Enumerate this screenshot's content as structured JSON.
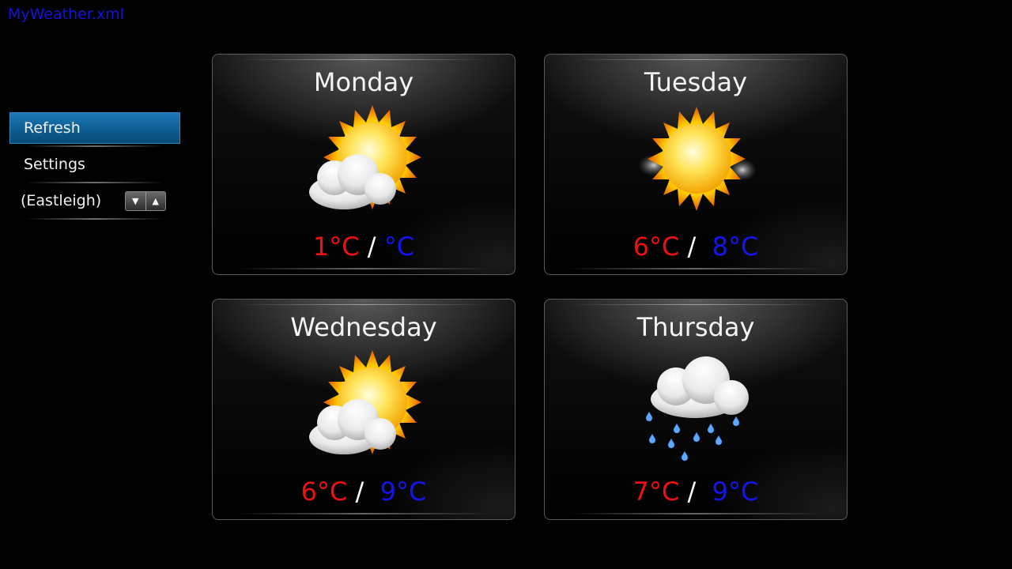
{
  "app": {
    "title": "MyWeather.xml"
  },
  "menu": {
    "refresh_label": "Refresh",
    "settings_label": "Settings",
    "location_label": "(Eastleigh)",
    "spinner_down": "▼",
    "spinner_up": "▲"
  },
  "days": [
    {
      "name": "Monday",
      "low": "1°C",
      "separator": " / ",
      "high": "°C",
      "icon": "partly-cloudy-icon"
    },
    {
      "name": "Tuesday",
      "low": "6°C",
      "separator": " /  ",
      "high": "8°C",
      "icon": "sunny-haze-icon"
    },
    {
      "name": "Wednesday",
      "low": "6°C",
      "separator": " /  ",
      "high": "9°C",
      "icon": "partly-cloudy-icon"
    },
    {
      "name": "Thursday",
      "low": "7°C",
      "separator": " /  ",
      "high": "9°C",
      "icon": "rain-cloud-icon"
    }
  ],
  "colors": {
    "low_temp": "#ee1111",
    "high_temp": "#1414ee",
    "title": "#1414d8",
    "selected_item": "#0f5d92"
  }
}
